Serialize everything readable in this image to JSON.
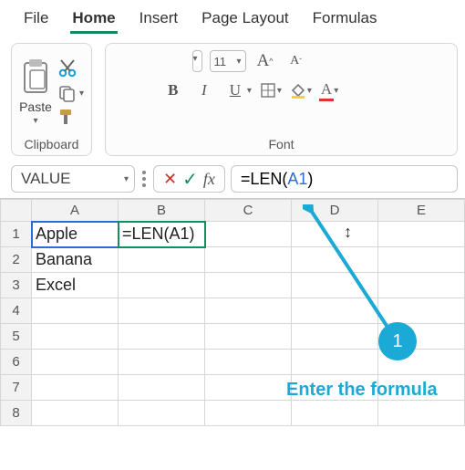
{
  "tabs": {
    "file": "File",
    "home": "Home",
    "insert": "Insert",
    "page_layout": "Page Layout",
    "formulas": "Formulas"
  },
  "clipboard": {
    "paste": "Paste",
    "label": "Clipboard"
  },
  "font": {
    "label": "Font",
    "size": "11",
    "larger": "A",
    "smaller": "A",
    "bold": "B",
    "italic": "I",
    "underline": "U"
  },
  "namebox": "VALUE",
  "formula_plain": "=LEN(",
  "formula_ref": "A1",
  "formula_tail": ")",
  "columns": [
    "A",
    "B",
    "C",
    "D",
    "E"
  ],
  "rows": [
    "1",
    "2",
    "3",
    "4",
    "5",
    "6",
    "7",
    "8"
  ],
  "cells": {
    "A1": "Apple",
    "A2": "Banana",
    "A3": "Excel",
    "B1": "=LEN(A1)"
  },
  "annotation": {
    "step": "1",
    "text": "Enter the formula"
  },
  "fx_label": "fx"
}
